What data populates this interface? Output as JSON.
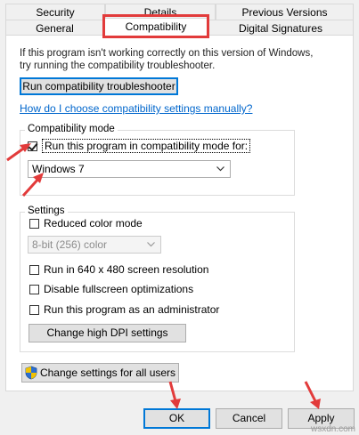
{
  "tabs_row1": [
    "Security",
    "Details",
    "Previous Versions"
  ],
  "tabs_row2": [
    "General",
    "Compatibility",
    "Digital Signatures"
  ],
  "intro_text": "If this program isn't working correctly on this version of Windows, try running the compatibility troubleshooter.",
  "troubleshooter_button": "Run compatibility troubleshooter",
  "manual_link": "How do I choose compatibility settings manually?",
  "compat_mode": {
    "legend": "Compatibility mode",
    "checkbox_label": "Run this program in compatibility mode for:",
    "checked": true,
    "selected_os": "Windows 7"
  },
  "settings": {
    "legend": "Settings",
    "reduced_color": "Reduced color mode",
    "color_select": "8-bit (256) color",
    "resolution": "Run in 640 x 480 screen resolution",
    "fullscreen": "Disable fullscreen optimizations",
    "admin": "Run this program as an administrator",
    "dpi_button": "Change high DPI settings"
  },
  "all_users_button": "Change settings for all users",
  "footer": {
    "ok": "OK",
    "cancel": "Cancel",
    "apply": "Apply"
  },
  "watermark": "wsxdn.com",
  "icons": {
    "shield": "uac-shield-icon",
    "chevron": "chevron-down-icon"
  },
  "colors": {
    "annotation_red": "#e23b3b",
    "link_blue": "#0066cc",
    "focus_blue": "#0078d7"
  }
}
